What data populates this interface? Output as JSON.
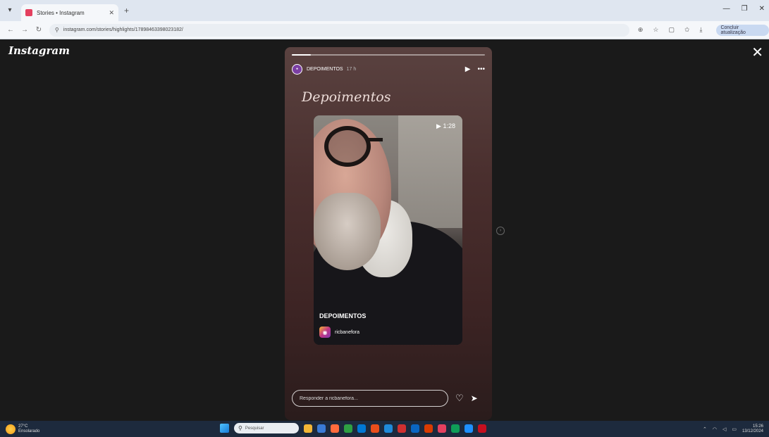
{
  "browser": {
    "tab_title": "Stories • Instagram",
    "url": "instagram.com/stories/highlights/17898463398023182/",
    "profile_label": "Concluir atualização"
  },
  "page": {
    "logo": "Instagram",
    "close_glyph": "✕"
  },
  "story": {
    "username": "DEPOIMENTOS",
    "time": "17 h",
    "title": "Depoimentos",
    "video": {
      "duration": "1:28",
      "label": "DEPOIMENTOS",
      "account": "ricbanefora"
    },
    "reply_placeholder": "Responder a ricbanefora...",
    "progress": 0.1
  },
  "taskbar": {
    "weather_temp": "27°C",
    "weather_desc": "Ensolarado",
    "search_placeholder": "Pesquisar",
    "time": "15:26",
    "date": "13/12/2024",
    "app_icons": [
      "#f2b636",
      "#3a7bd5",
      "#ff6b3d",
      "#2ea043",
      "#0078d4",
      "#e94e1b",
      "#1f8ad9",
      "#cf3030",
      "#0a66c2",
      "#d83b01",
      "#e4405f",
      "#0f9d58",
      "#1e90ff",
      "#c50f1f"
    ]
  }
}
